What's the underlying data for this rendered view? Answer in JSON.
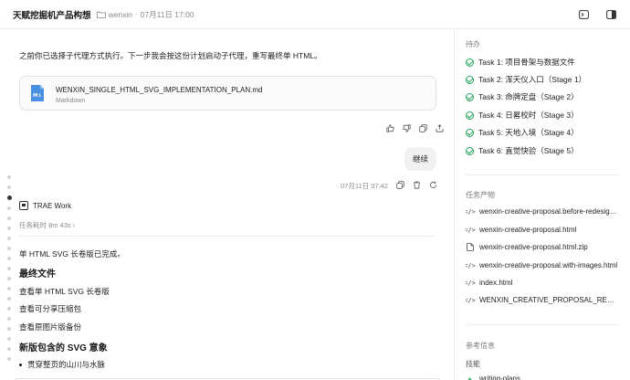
{
  "header": {
    "title": "天赋挖掘机产品构想",
    "user": "wenxin",
    "datetime": "07月11日 17:00",
    "separator": "·"
  },
  "chat": {
    "intro": "之前你已选择子代理方式执行。下一步我会按这份计划启动子代理，重写最终单 HTML。",
    "file": {
      "name": "WENXIN_SINGLE_HTML_SVG_IMPLEMENTATION_PLAN.md",
      "type": "Markdown",
      "icon": "markdown-file-icon"
    },
    "user_message": "继续",
    "user_message_time": "07月11日 07:42",
    "agent_name": "TRAE Work",
    "elapsed": "任务耗时 8m 43s",
    "elapsed_chevron": "›",
    "summary": "单 HTML SVG 长卷版已完成。",
    "final_files_heading": "最终文件",
    "final_links": [
      "查看单 HTML SVG 长卷版",
      "查看可分享压缩包",
      "查看原图片版备份"
    ],
    "svg_heading": "新版包含的 SVG 意象",
    "svg_bullets": [
      "贯穿整页的山川与水脉"
    ]
  },
  "sidebar": {
    "todo_title": "待办",
    "todos": [
      "Task 1: 项目骨架与数据文件",
      "Task 2: 浑天仪入口（Stage 1）",
      "Task 3: 命牌定盘（Stage 2）",
      "Task 4: 日晷校时（Stage 3）",
      "Task 5: 天地入境（Stage 4）",
      "Task 6: 直觉快验（Stage 5）"
    ],
    "artifacts_title": "任务产物",
    "artifacts": [
      {
        "label": "wenxin-creative-proposal.before-redesign.html",
        "icon": "code-icon"
      },
      {
        "label": "wenxin-creative-proposal.html",
        "icon": "code-icon"
      },
      {
        "label": "wenxin-creative-proposal.html.zip",
        "icon": "file-icon"
      },
      {
        "label": "wenxin-creative-proposal.with-images.html",
        "icon": "code-icon"
      },
      {
        "label": "index.html",
        "icon": "code-icon"
      },
      {
        "label": "WENXIN_CREATIVE_PROPOSAL_REDESIGN.md",
        "icon": "code-icon"
      }
    ],
    "reference_title": "参考信息",
    "skills_title": "技能",
    "skill_item": "writing-plans"
  },
  "colors": {
    "accent_green": "#22a45a",
    "muted": "#8a8a8a",
    "border": "#ececec"
  }
}
